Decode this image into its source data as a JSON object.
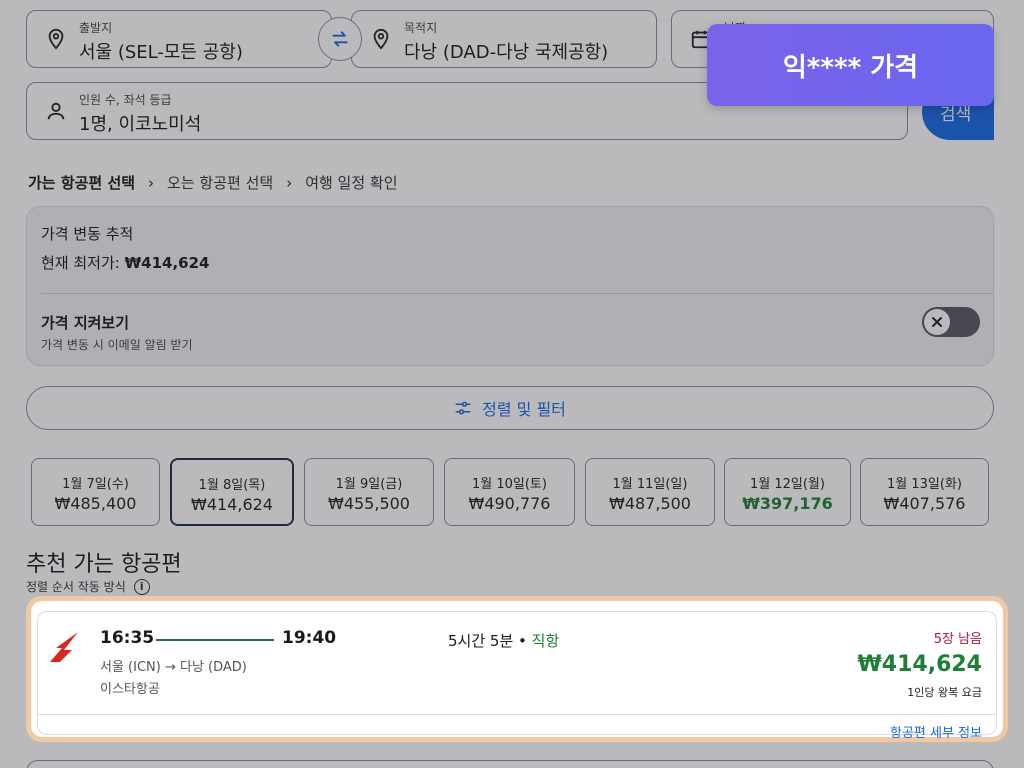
{
  "search": {
    "origin": {
      "label": "출발지",
      "value": "서울 (SEL-모든 공항)"
    },
    "destination": {
      "label": "목적지",
      "value": "다낭 (DAD-다낭 국제공항)"
    },
    "dates": {
      "label": "날짜",
      "value": ""
    },
    "travelers": {
      "label": "인원 수, 좌석 등급",
      "value": "1명, 이코노미석"
    },
    "search_label": "검색"
  },
  "breadcrumb": {
    "step1": "가는 항공편 선택",
    "step2": "오는 항공편 선택",
    "step3": "여행 일정 확인"
  },
  "price_tracker": {
    "title": "가격 변동 추적",
    "lowest_label": "현재 최저가: ",
    "lowest_value": "₩414,624",
    "watch_title": "가격 지켜보기",
    "watch_subtitle": "가격 변동 시 이메일 알림 받기",
    "toggle_on": false
  },
  "sort_filter_label": "정렬 및 필터",
  "date_options": [
    {
      "day": "1월 7일(수)",
      "price": "₩485,400",
      "selected": false,
      "lowest": false
    },
    {
      "day": "1월 8일(목)",
      "price": "₩414,624",
      "selected": true,
      "lowest": false
    },
    {
      "day": "1월 9일(금)",
      "price": "₩455,500",
      "selected": false,
      "lowest": false
    },
    {
      "day": "1월 10일(토)",
      "price": "₩490,776",
      "selected": false,
      "lowest": false
    },
    {
      "day": "1월 11일(일)",
      "price": "₩487,500",
      "selected": false,
      "lowest": false
    },
    {
      "day": "1월 12일(월)",
      "price": "₩397,176",
      "selected": false,
      "lowest": true
    },
    {
      "day": "1월 13일(화)",
      "price": "₩407,576",
      "selected": false,
      "lowest": false
    }
  ],
  "recommended": {
    "title": "추천 가는 항공편",
    "sort_info": "정렬 순서 작동 방식"
  },
  "flight": {
    "depart_time": "16:35",
    "arrive_time": "19:40",
    "route": "서울 (ICN) → 다낭 (DAD)",
    "airline": "이스타항공",
    "duration": "5시간 5분",
    "separator": " • ",
    "stops": "직항",
    "seats_left": "5장 남음",
    "price": "₩414,624",
    "price_note": "1인당 왕복 요금",
    "details_link": "항공편 세부 정보"
  },
  "toast": {
    "text": "익**** 가격"
  },
  "colors": {
    "accent": "#1668e3",
    "green": "#1e7e34",
    "seats_red": "#a61c3c",
    "toast": "#7366ee",
    "highlight": "#f2c8a4"
  }
}
